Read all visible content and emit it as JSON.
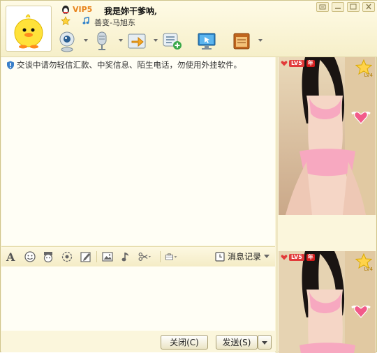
{
  "header": {
    "vip_label": "VIP5",
    "nickname": "我是妳干爹呐,",
    "song": "善变-马旭东"
  },
  "toolbar": {
    "items": [
      {
        "icon": "webcam-icon"
      },
      {
        "icon": "microphone-icon"
      },
      {
        "icon": "file-transfer-icon"
      },
      {
        "icon": "group-chat-icon"
      },
      {
        "icon": "remote-desktop-icon"
      },
      {
        "icon": "app-box-icon"
      }
    ]
  },
  "chat": {
    "notice": "交谈中请勿轻信汇款、中奖信息、陌生电话，勿使用外挂软件。"
  },
  "format_bar": {
    "history_label": "消息记录"
  },
  "buttons": {
    "close_label": "关闭(C)",
    "send_label": "发送(S)"
  },
  "video_panel": {
    "level_badge": "LV5",
    "year_badge": "年",
    "level_small": "LV4"
  },
  "colors": {
    "header_bg": "#fbf6dc",
    "accent_orange": "#e8841e",
    "badge_red": "#e23a3a"
  }
}
